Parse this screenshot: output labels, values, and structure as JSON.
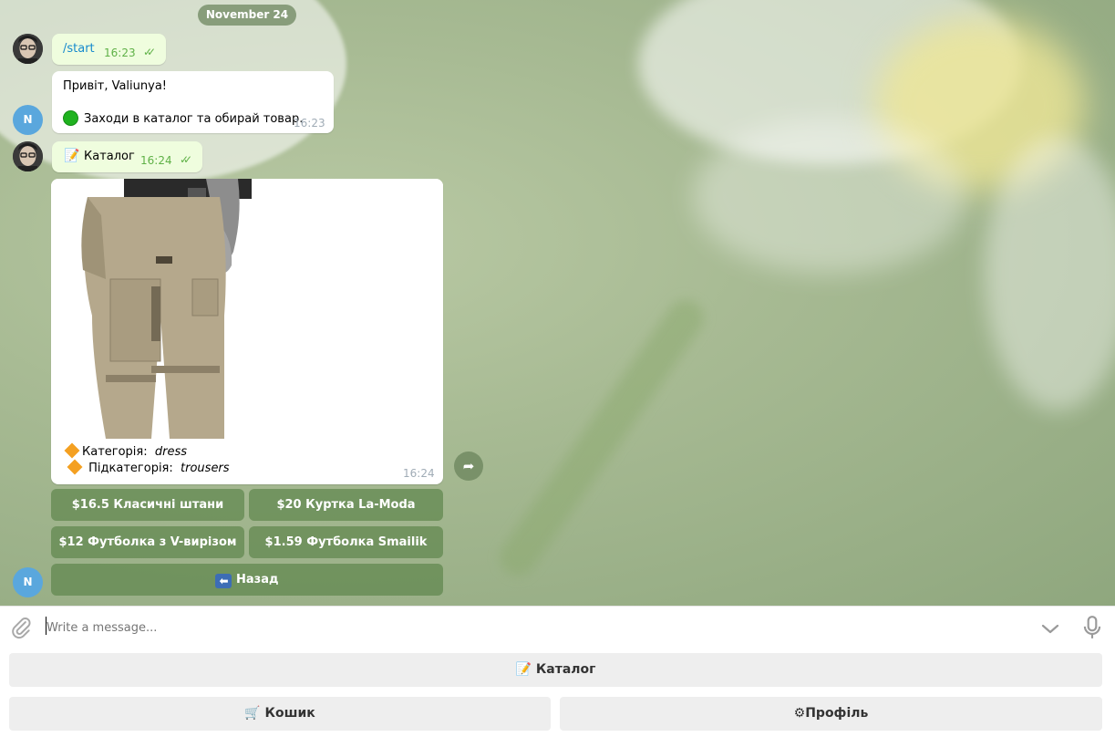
{
  "chat": {
    "date": "November 24",
    "messages": [
      {
        "author": "user",
        "text": "/start",
        "time": "16:23"
      },
      {
        "author": "bot",
        "greeting": "Привіт, Valiunya!",
        "text": "Заходи в каталог та обирай товар.",
        "time": "16:23"
      },
      {
        "author": "user",
        "text": "Каталог",
        "time": "16:24"
      },
      {
        "author": "bot",
        "category_label": "Категорія:",
        "category_value": "dress",
        "subcategory_label": "Підкатегорія:",
        "subcategory_value": "trousers",
        "time": "16:24"
      }
    ],
    "bot_avatar_letter": "N",
    "inline_keyboard": [
      "$16.5 Класичні штани",
      "$20 Куртка La-Moda",
      "$12 Футболка з V-вирізом",
      "$1.59 Футболка Smailik",
      "Назад"
    ]
  },
  "input": {
    "placeholder": "Write a message..."
  },
  "reply_keyboard": {
    "catalog": "Каталог",
    "cart": "Кошик",
    "profile": "Профіль"
  },
  "colors": {
    "outgoing_bubble": "#effdde",
    "incoming_bubble": "#ffffff",
    "command_link": "#168acd",
    "check_marks": "#5fb147",
    "inline_button": "#5f874e",
    "bot_avatar": "#5aa7dd"
  },
  "icons": [
    "attach-icon",
    "chevron-down-icon",
    "microphone-icon",
    "share-icon",
    "memo-emoji",
    "cart-emoji",
    "gear-emoji",
    "back-arrow-emoji",
    "green-circle-emoji",
    "orange-diamond-emoji"
  ]
}
